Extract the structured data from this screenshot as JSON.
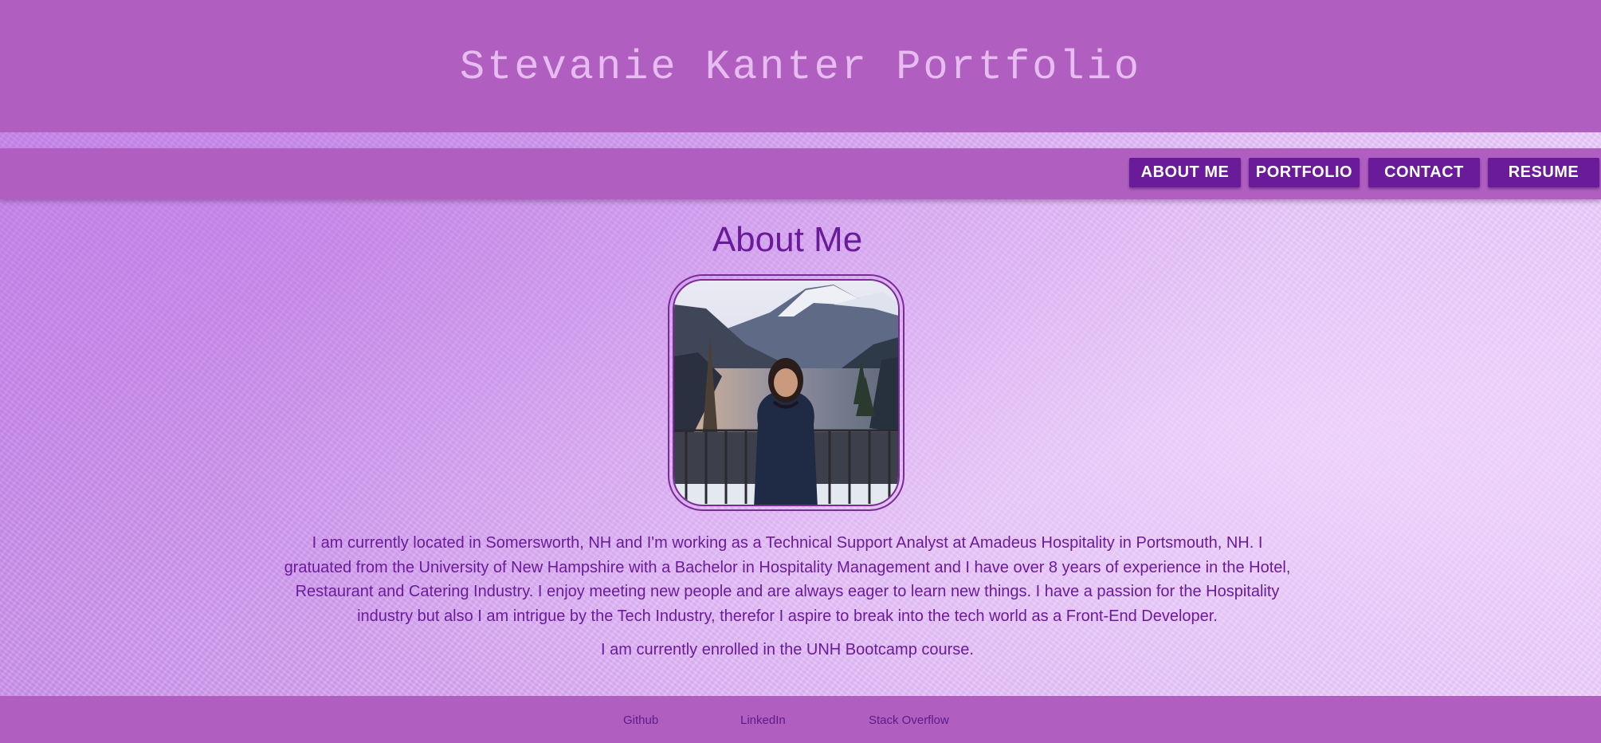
{
  "header": {
    "title": "Stevanie Kanter Portfolio"
  },
  "nav": {
    "about": "ABOUT ME",
    "portfolio": "PORTFOLIO",
    "contact": "CONTACT",
    "resume": "RESUME"
  },
  "about": {
    "heading": "About Me",
    "paragraph1": "I am currently located in Somersworth, NH and I'm working as a Technical Support Analyst at Amadeus Hospitality in Portsmouth, NH. I gratuated from the University of New Hampshire with a Bachelor in Hospitality Management and I have over 8 years of experience in the Hotel, Restaurant and Catering Industry. I enjoy meeting new people and are always eager to learn new things. I have a passion for the Hospitality industry but also I am intrigue by the Tech Industry, therefor I aspire to break into the tech world as a Front-End Developer.",
    "paragraph2": "I am currently enrolled in the UNH Bootcamp course."
  },
  "footer": {
    "links": [
      "Github",
      "LinkedIn",
      "Stack Overflow"
    ]
  },
  "colors": {
    "header_bg": "#b05fc0",
    "button_bg": "#6a1b9a",
    "text_purple": "#6a1b9a",
    "title_text": "#e7bdf1"
  }
}
